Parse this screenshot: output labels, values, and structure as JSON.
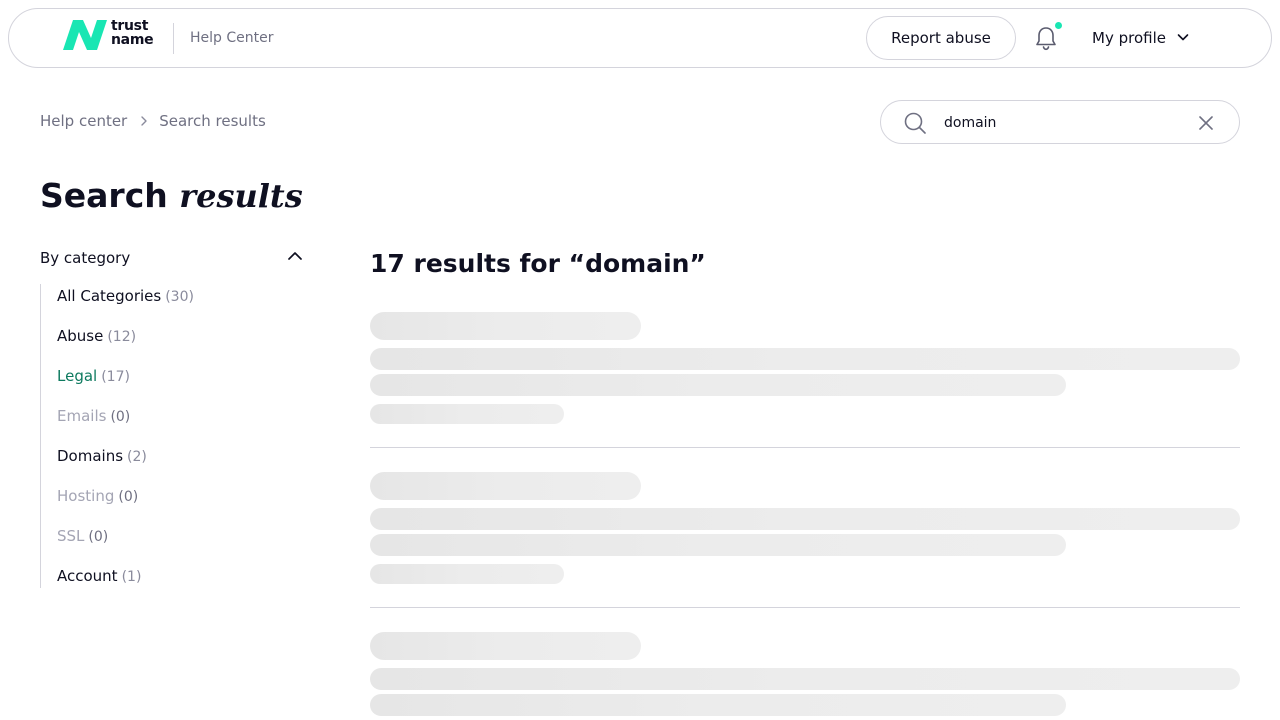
{
  "header": {
    "logo_text_line1": "trust",
    "logo_text_line2": "name",
    "section_label": "Help Center",
    "report_abuse_label": "Report abuse",
    "profile_label": "My profile",
    "brand_color": "#19e6b3",
    "notification_dot": true
  },
  "breadcrumb": {
    "items": [
      "Help center",
      "Search results"
    ]
  },
  "search": {
    "value": "domain"
  },
  "page_title": {
    "plain": "Search",
    "emphasis": "results"
  },
  "sidebar": {
    "header_label": "By category",
    "expanded": true,
    "categories": [
      {
        "name": "All Categories",
        "count": "(30)",
        "state": "normal"
      },
      {
        "name": "Abuse",
        "count": "(12)",
        "state": "normal"
      },
      {
        "name": "Legal",
        "count": "(17)",
        "state": "active"
      },
      {
        "name": "Emails",
        "count": "(0)",
        "state": "disabled"
      },
      {
        "name": "Domains",
        "count": "(2)",
        "state": "normal"
      },
      {
        "name": "Hosting",
        "count": "(0)",
        "state": "disabled"
      },
      {
        "name": "SSL",
        "count": "(0)",
        "state": "disabled"
      },
      {
        "name": "Account",
        "count": "(1)",
        "state": "normal"
      }
    ]
  },
  "results": {
    "heading": "17 results for “domain”",
    "loading": true,
    "skeleton_cards_visible": 3
  },
  "icons": {
    "search": "search-icon",
    "clear": "close-icon",
    "bell": "bell-icon",
    "chevron_down": "chevron-down-icon",
    "chevron_up": "chevron-up-icon",
    "chevron_right": "chevron-right-icon"
  }
}
